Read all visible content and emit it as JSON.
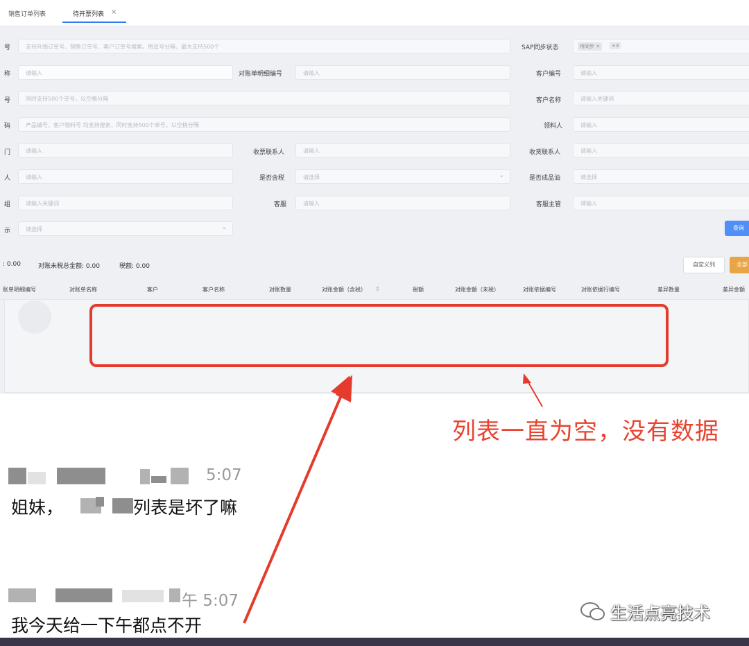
{
  "tabs": [
    {
      "label": "销售订单列表"
    },
    {
      "label": "待开票列表",
      "active": true,
      "close": "×"
    }
  ],
  "form": {
    "row1": {
      "label_left": "号",
      "placeholder": "支持外围订单号、销售订单号、客户订单号搜索。用逗号分隔，最大支持500个",
      "sap_label": "SAP同步状态",
      "sap_tag": "待同步 ✕",
      "sap_more": "+3"
    },
    "row2": {
      "label_left": "称",
      "placeholder_a": "请输入",
      "mid_label": "对账单明细编号",
      "placeholder_b": "请输入",
      "right_label": "客户编号",
      "placeholder_c": "请输入"
    },
    "row3": {
      "label_left": "号",
      "placeholder_a": "同时支持500个单号，以空格分隔",
      "right_label": "客户名称",
      "placeholder_c": "请输入关键词"
    },
    "row4": {
      "label_left": "码",
      "placeholder_a": "产品编号、客户物料号 均支持搜索，同时支持500个单号，以空格分隔",
      "right_label": "领料人",
      "placeholder_c": "请输入"
    },
    "row5": {
      "label_left": "门",
      "placeholder_a": "请输入",
      "mid_label": "收票联系人",
      "placeholder_b": "请输入",
      "right_label": "收货联系人",
      "placeholder_c": "请输入"
    },
    "row6": {
      "label_left": "人",
      "placeholder_a": "请输入",
      "mid_label": "是否含税",
      "placeholder_b": "请选择",
      "right_label": "是否成品油",
      "placeholder_c": "请选择"
    },
    "row7": {
      "label_left": "组",
      "placeholder_a": "请输入关键词",
      "mid_label": "客服",
      "placeholder_b": "请输入",
      "right_label": "客服主管",
      "placeholder_c": "请输入"
    },
    "row8": {
      "label_left": "示",
      "placeholder_a": "请选择"
    },
    "query_button": "查询"
  },
  "summary": {
    "a": ": 0.00",
    "b": "对账未税总金额: 0.00",
    "c": "税额: 0.00"
  },
  "buttons": {
    "custom_columns": "自定义列",
    "all": "全部"
  },
  "columns": [
    "账单明细编号",
    "对账单名称",
    "客户",
    "客户名称",
    "对账数量",
    "对账金额（含税）",
    "税额",
    "对账金额（未税）",
    "对账依据编号",
    "对账依据行编号",
    "差异数量",
    "差异金额"
  ],
  "annotation": "列表一直为空，没有数据",
  "chat": [
    {
      "time": "5:07",
      "text_before": "姐妹，",
      "text_after": "列表是坏了嘛"
    },
    {
      "time": "午 5:07",
      "text": "我今天给一下午都点不开"
    }
  ],
  "watermark": "生活点亮技术",
  "colors": {
    "accent": "#2f7cf6",
    "annotation_red": "#e53b2c",
    "query_blue": "#4f8ff7",
    "orange": "#e7a544"
  }
}
